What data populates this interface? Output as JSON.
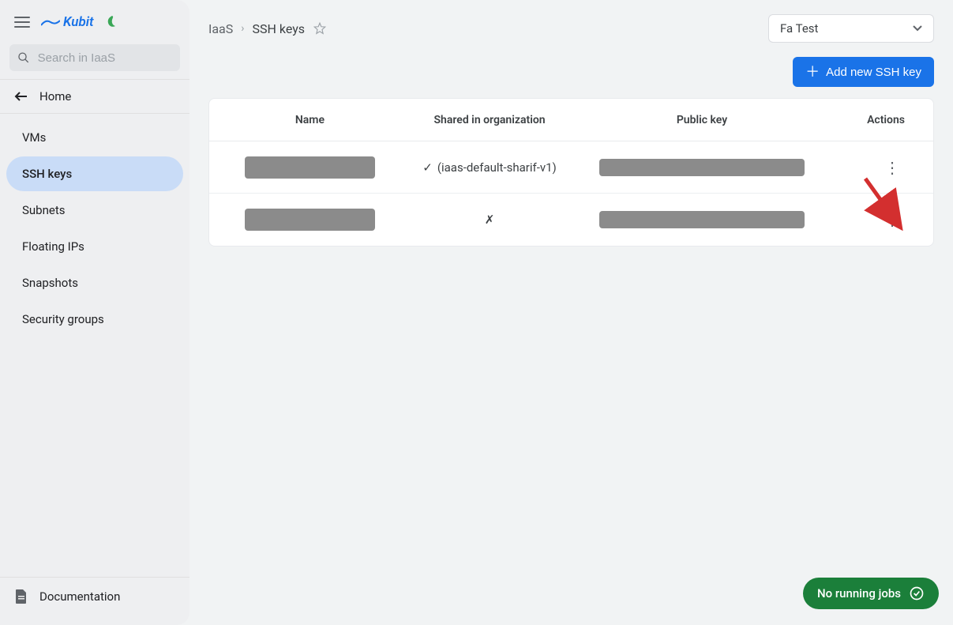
{
  "brand": {
    "name": "Kubit"
  },
  "search": {
    "placeholder": "Search in IaaS"
  },
  "home": {
    "label": "Home"
  },
  "sidebar": {
    "items": [
      {
        "label": "VMs"
      },
      {
        "label": "SSH keys"
      },
      {
        "label": "Subnets"
      },
      {
        "label": "Floating IPs"
      },
      {
        "label": "Snapshots"
      },
      {
        "label": "Security groups"
      }
    ],
    "active_index": 1,
    "doc_label": "Documentation"
  },
  "breadcrumb": {
    "root": "IaaS",
    "current": "SSH keys"
  },
  "org": {
    "selected": "Fa Test"
  },
  "add_button": {
    "label": "Add new SSH key"
  },
  "table": {
    "headers": {
      "name": "Name",
      "shared": "Shared in organization",
      "pubkey": "Public key",
      "actions": "Actions"
    },
    "rows": [
      {
        "name_redacted": true,
        "shared": true,
        "shared_text": "(iaas-default-sharif-v1)",
        "pubkey_redacted": true
      },
      {
        "name_redacted": true,
        "shared": false,
        "shared_text": "",
        "pubkey_redacted": true
      }
    ]
  },
  "jobs": {
    "label": "No running jobs"
  }
}
